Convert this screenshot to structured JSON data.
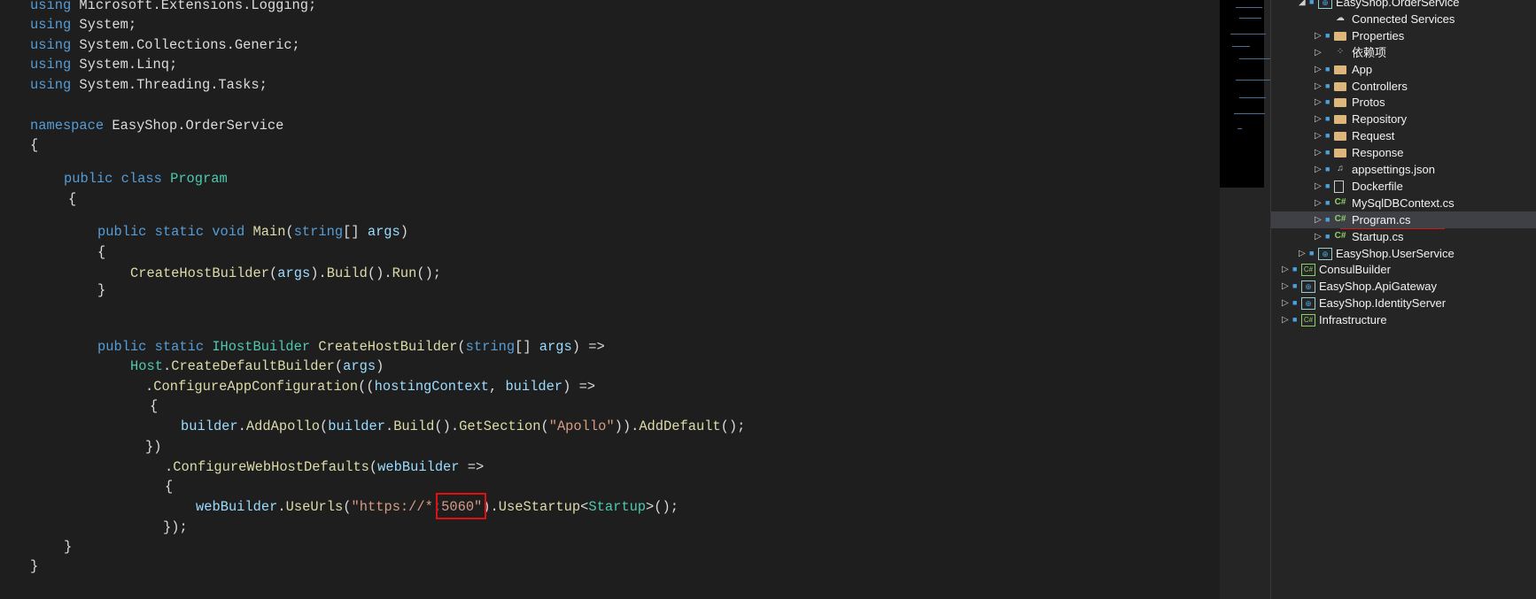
{
  "editor": {
    "lines": [
      [
        [
          "using ",
          "kw"
        ],
        [
          "Microsoft.Extensions.Logging;",
          "pl"
        ]
      ],
      [
        [
          "using ",
          "kw"
        ],
        [
          "System;",
          "pl"
        ]
      ],
      [
        [
          "using ",
          "kw"
        ],
        [
          "System.Collections.Generic;",
          "pl"
        ]
      ],
      [
        [
          "using ",
          "kw"
        ],
        [
          "System.Linq;",
          "pl"
        ]
      ],
      [
        [
          "using ",
          "kw"
        ],
        [
          "System.Threading.Tasks;",
          "pl"
        ]
      ],
      [
        [
          "namespace ",
          "kw"
        ],
        [
          "EasyShop.OrderService",
          "pl"
        ]
      ],
      [
        [
          "{",
          "pl"
        ]
      ],
      [
        [
          "public class ",
          "kw"
        ],
        [
          "Program",
          "ty"
        ]
      ],
      [
        [
          "{",
          "pl"
        ]
      ],
      [
        [
          "public static void ",
          "kw"
        ],
        [
          "Main",
          "fn"
        ],
        [
          "(",
          "pl"
        ],
        [
          "string",
          "kw"
        ],
        [
          "[] ",
          "pl"
        ],
        [
          "args",
          "pa"
        ],
        [
          ")",
          "pl"
        ]
      ],
      [
        [
          "{",
          "pl"
        ]
      ],
      [
        [
          "CreateHostBuilder",
          "fn"
        ],
        [
          "(",
          "pl"
        ],
        [
          "args",
          "pa"
        ],
        [
          ").",
          "pl"
        ],
        [
          "Build",
          "fn"
        ],
        [
          "().",
          "pl"
        ],
        [
          "Run",
          "fn"
        ],
        [
          "();",
          "pl"
        ]
      ],
      [
        [
          "}",
          "pl"
        ]
      ],
      [
        [
          "public static ",
          "kw"
        ],
        [
          "IHostBuilder ",
          "ty"
        ],
        [
          "CreateHostBuilder",
          "fn"
        ],
        [
          "(",
          "pl"
        ],
        [
          "string",
          "kw"
        ],
        [
          "[] ",
          "pl"
        ],
        [
          "args",
          "pa"
        ],
        [
          ") =>",
          "pl"
        ]
      ],
      [
        [
          "Host",
          "ty"
        ],
        [
          ".",
          "pl"
        ],
        [
          "CreateDefaultBuilder",
          "fn"
        ],
        [
          "(",
          "pl"
        ],
        [
          "args",
          "pa"
        ],
        [
          ")",
          "pl"
        ]
      ],
      [
        [
          ".",
          "pl"
        ],
        [
          "ConfigureAppConfiguration",
          "fn"
        ],
        [
          "((",
          "pl"
        ],
        [
          "hostingContext",
          "pa"
        ],
        [
          ", ",
          "pl"
        ],
        [
          "builder",
          "pa"
        ],
        [
          ") =>",
          "pl"
        ]
      ],
      [
        [
          "{",
          "pl"
        ]
      ],
      [
        [
          "builder",
          "pa"
        ],
        [
          ".",
          "pl"
        ],
        [
          "AddApollo",
          "fn"
        ],
        [
          "(",
          "pl"
        ],
        [
          "builder",
          "pa"
        ],
        [
          ".",
          "pl"
        ],
        [
          "Build",
          "fn"
        ],
        [
          "().",
          "pl"
        ],
        [
          "GetSection",
          "fn"
        ],
        [
          "(",
          "pl"
        ],
        [
          "\"Apollo\"",
          "st"
        ],
        [
          ")).",
          "pl"
        ],
        [
          "AddDefault",
          "fn"
        ],
        [
          "();",
          "pl"
        ]
      ],
      [
        [
          "})",
          "pl"
        ]
      ],
      [
        [
          ".",
          "pl"
        ],
        [
          "ConfigureWebHostDefaults",
          "fn"
        ],
        [
          "(",
          "pl"
        ],
        [
          "webBuilder",
          "pa"
        ],
        [
          " =>",
          "pl"
        ]
      ],
      [
        [
          "{",
          "pl"
        ]
      ],
      [
        [
          "webBuilder",
          "pa"
        ],
        [
          ".",
          "pl"
        ],
        [
          "UseUrls",
          "fn"
        ],
        [
          "(",
          "pl"
        ],
        [
          "\"https://*:5060\"",
          "st"
        ],
        [
          ").",
          "pl"
        ],
        [
          "UseStartup",
          "fn"
        ],
        [
          "<",
          "pl"
        ],
        [
          "Startup",
          "ty"
        ],
        [
          ">();",
          "pl"
        ]
      ],
      [
        [
          "});",
          "pl"
        ]
      ],
      [
        [
          "}",
          "pl"
        ]
      ],
      [
        [
          "}",
          "pl"
        ]
      ]
    ]
  },
  "solution_explorer": {
    "items": [
      {
        "label": "EasyShop.OrderService",
        "icon": "web-project-icon",
        "expanded": true,
        "level": 1
      },
      {
        "label": "Connected Services",
        "icon": "connected-services-icon",
        "level": 2
      },
      {
        "label": "Properties",
        "icon": "properties-folder-icon",
        "level": 2
      },
      {
        "label": "依赖项",
        "icon": "dependencies-icon",
        "level": 2
      },
      {
        "label": "App",
        "icon": "folder-icon",
        "level": 2
      },
      {
        "label": "Controllers",
        "icon": "folder-icon",
        "level": 2
      },
      {
        "label": "Protos",
        "icon": "folder-icon",
        "level": 2
      },
      {
        "label": "Repository",
        "icon": "folder-icon",
        "level": 2
      },
      {
        "label": "Request",
        "icon": "folder-icon",
        "level": 2
      },
      {
        "label": "Response",
        "icon": "folder-icon",
        "level": 2
      },
      {
        "label": "appsettings.json",
        "icon": "json-file-icon",
        "level": 2
      },
      {
        "label": "Dockerfile",
        "icon": "file-icon",
        "level": 2
      },
      {
        "label": "MySqlDBContext.cs",
        "icon": "csharp-file-icon",
        "level": 2
      },
      {
        "label": "Program.cs",
        "icon": "csharp-file-icon",
        "level": 2,
        "selected": true
      },
      {
        "label": "Startup.cs",
        "icon": "csharp-file-icon",
        "level": 2
      },
      {
        "label": "EasyShop.UserService",
        "icon": "web-project-icon",
        "level": 1
      },
      {
        "label": "ConsulBuilder",
        "icon": "csharp-project-icon",
        "level": 0
      },
      {
        "label": "EasyShop.ApiGateway",
        "icon": "web-project-icon",
        "level": 0
      },
      {
        "label": "EasyShop.IdentityServer",
        "icon": "web-project-icon",
        "level": 0
      },
      {
        "label": "Infrastructure",
        "icon": "csharp-project-icon",
        "level": 0
      }
    ]
  },
  "colors": {
    "keyword": "#569cd6",
    "type": "#4ec9b0",
    "method": "#dcdcaa",
    "parameter": "#9cdcfe",
    "string": "#d69d85",
    "highlight": "#e01010"
  }
}
